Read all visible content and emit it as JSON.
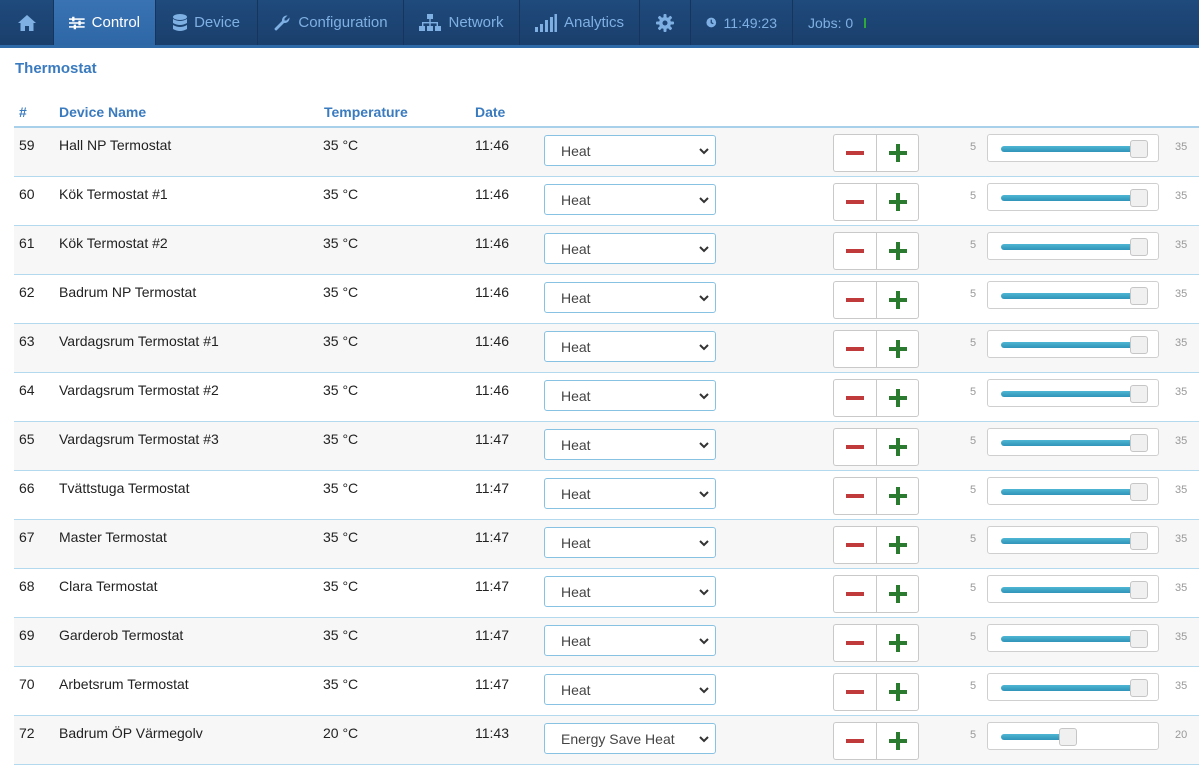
{
  "nav": {
    "items": [
      {
        "label": "",
        "icon": "home-icon"
      },
      {
        "label": "Control",
        "icon": "sliders-icon",
        "active": true
      },
      {
        "label": "Device",
        "icon": "database-icon"
      },
      {
        "label": "Configuration",
        "icon": "wrench-icon"
      },
      {
        "label": "Network",
        "icon": "sitemap-icon"
      },
      {
        "label": "Analytics",
        "icon": "bar-chart-icon"
      },
      {
        "label": "",
        "icon": "gear-icon"
      }
    ],
    "clock": "11:49:23",
    "jobs": "Jobs: 0",
    "jobs_status_color": "#2eaa3a"
  },
  "page_title": "Thermostat",
  "table": {
    "headers": {
      "num": "#",
      "name": "Device Name",
      "temp": "Temperature",
      "date": "Date"
    },
    "rows": [
      {
        "num": "59",
        "name": "Hall NP Termostat",
        "temp": "35 °C",
        "date": "11:46",
        "mode": "Heat",
        "min": "5",
        "max": "35",
        "level": 1.0
      },
      {
        "num": "60",
        "name": "Kök Termostat #1",
        "temp": "35 °C",
        "date": "11:46",
        "mode": "Heat",
        "min": "5",
        "max": "35",
        "level": 1.0
      },
      {
        "num": "61",
        "name": "Kök Termostat #2",
        "temp": "35 °C",
        "date": "11:46",
        "mode": "Heat",
        "min": "5",
        "max": "35",
        "level": 1.0
      },
      {
        "num": "62",
        "name": "Badrum NP Termostat",
        "temp": "35 °C",
        "date": "11:46",
        "mode": "Heat",
        "min": "5",
        "max": "35",
        "level": 1.0
      },
      {
        "num": "63",
        "name": "Vardagsrum Termostat #1",
        "temp": "35 °C",
        "date": "11:46",
        "mode": "Heat",
        "min": "5",
        "max": "35",
        "level": 1.0
      },
      {
        "num": "64",
        "name": "Vardagsrum Termostat #2",
        "temp": "35 °C",
        "date": "11:46",
        "mode": "Heat",
        "min": "5",
        "max": "35",
        "level": 1.0
      },
      {
        "num": "65",
        "name": "Vardagsrum Termostat #3",
        "temp": "35 °C",
        "date": "11:47",
        "mode": "Heat",
        "min": "5",
        "max": "35",
        "level": 1.0
      },
      {
        "num": "66",
        "name": "Tvättstuga Termostat",
        "temp": "35 °C",
        "date": "11:47",
        "mode": "Heat",
        "min": "5",
        "max": "35",
        "level": 1.0
      },
      {
        "num": "67",
        "name": "Master Termostat",
        "temp": "35 °C",
        "date": "11:47",
        "mode": "Heat",
        "min": "5",
        "max": "35",
        "level": 1.0
      },
      {
        "num": "68",
        "name": "Clara Termostat",
        "temp": "35 °C",
        "date": "11:47",
        "mode": "Heat",
        "min": "5",
        "max": "35",
        "level": 1.0
      },
      {
        "num": "69",
        "name": "Garderob Termostat",
        "temp": "35 °C",
        "date": "11:47",
        "mode": "Heat",
        "min": "5",
        "max": "35",
        "level": 1.0
      },
      {
        "num": "70",
        "name": "Arbetsrum Termostat",
        "temp": "35 °C",
        "date": "11:47",
        "mode": "Heat",
        "min": "5",
        "max": "35",
        "level": 1.0
      },
      {
        "num": "72",
        "name": "Badrum ÖP Värmegolv",
        "temp": "20 °C",
        "date": "11:43",
        "mode": "Energy Save Heat",
        "min": "5",
        "max": "20",
        "level": 0.45
      }
    ]
  },
  "colors": {
    "minus": "#c0393b",
    "plus": "#2a7a2f",
    "accent": "#3a7bbf"
  }
}
